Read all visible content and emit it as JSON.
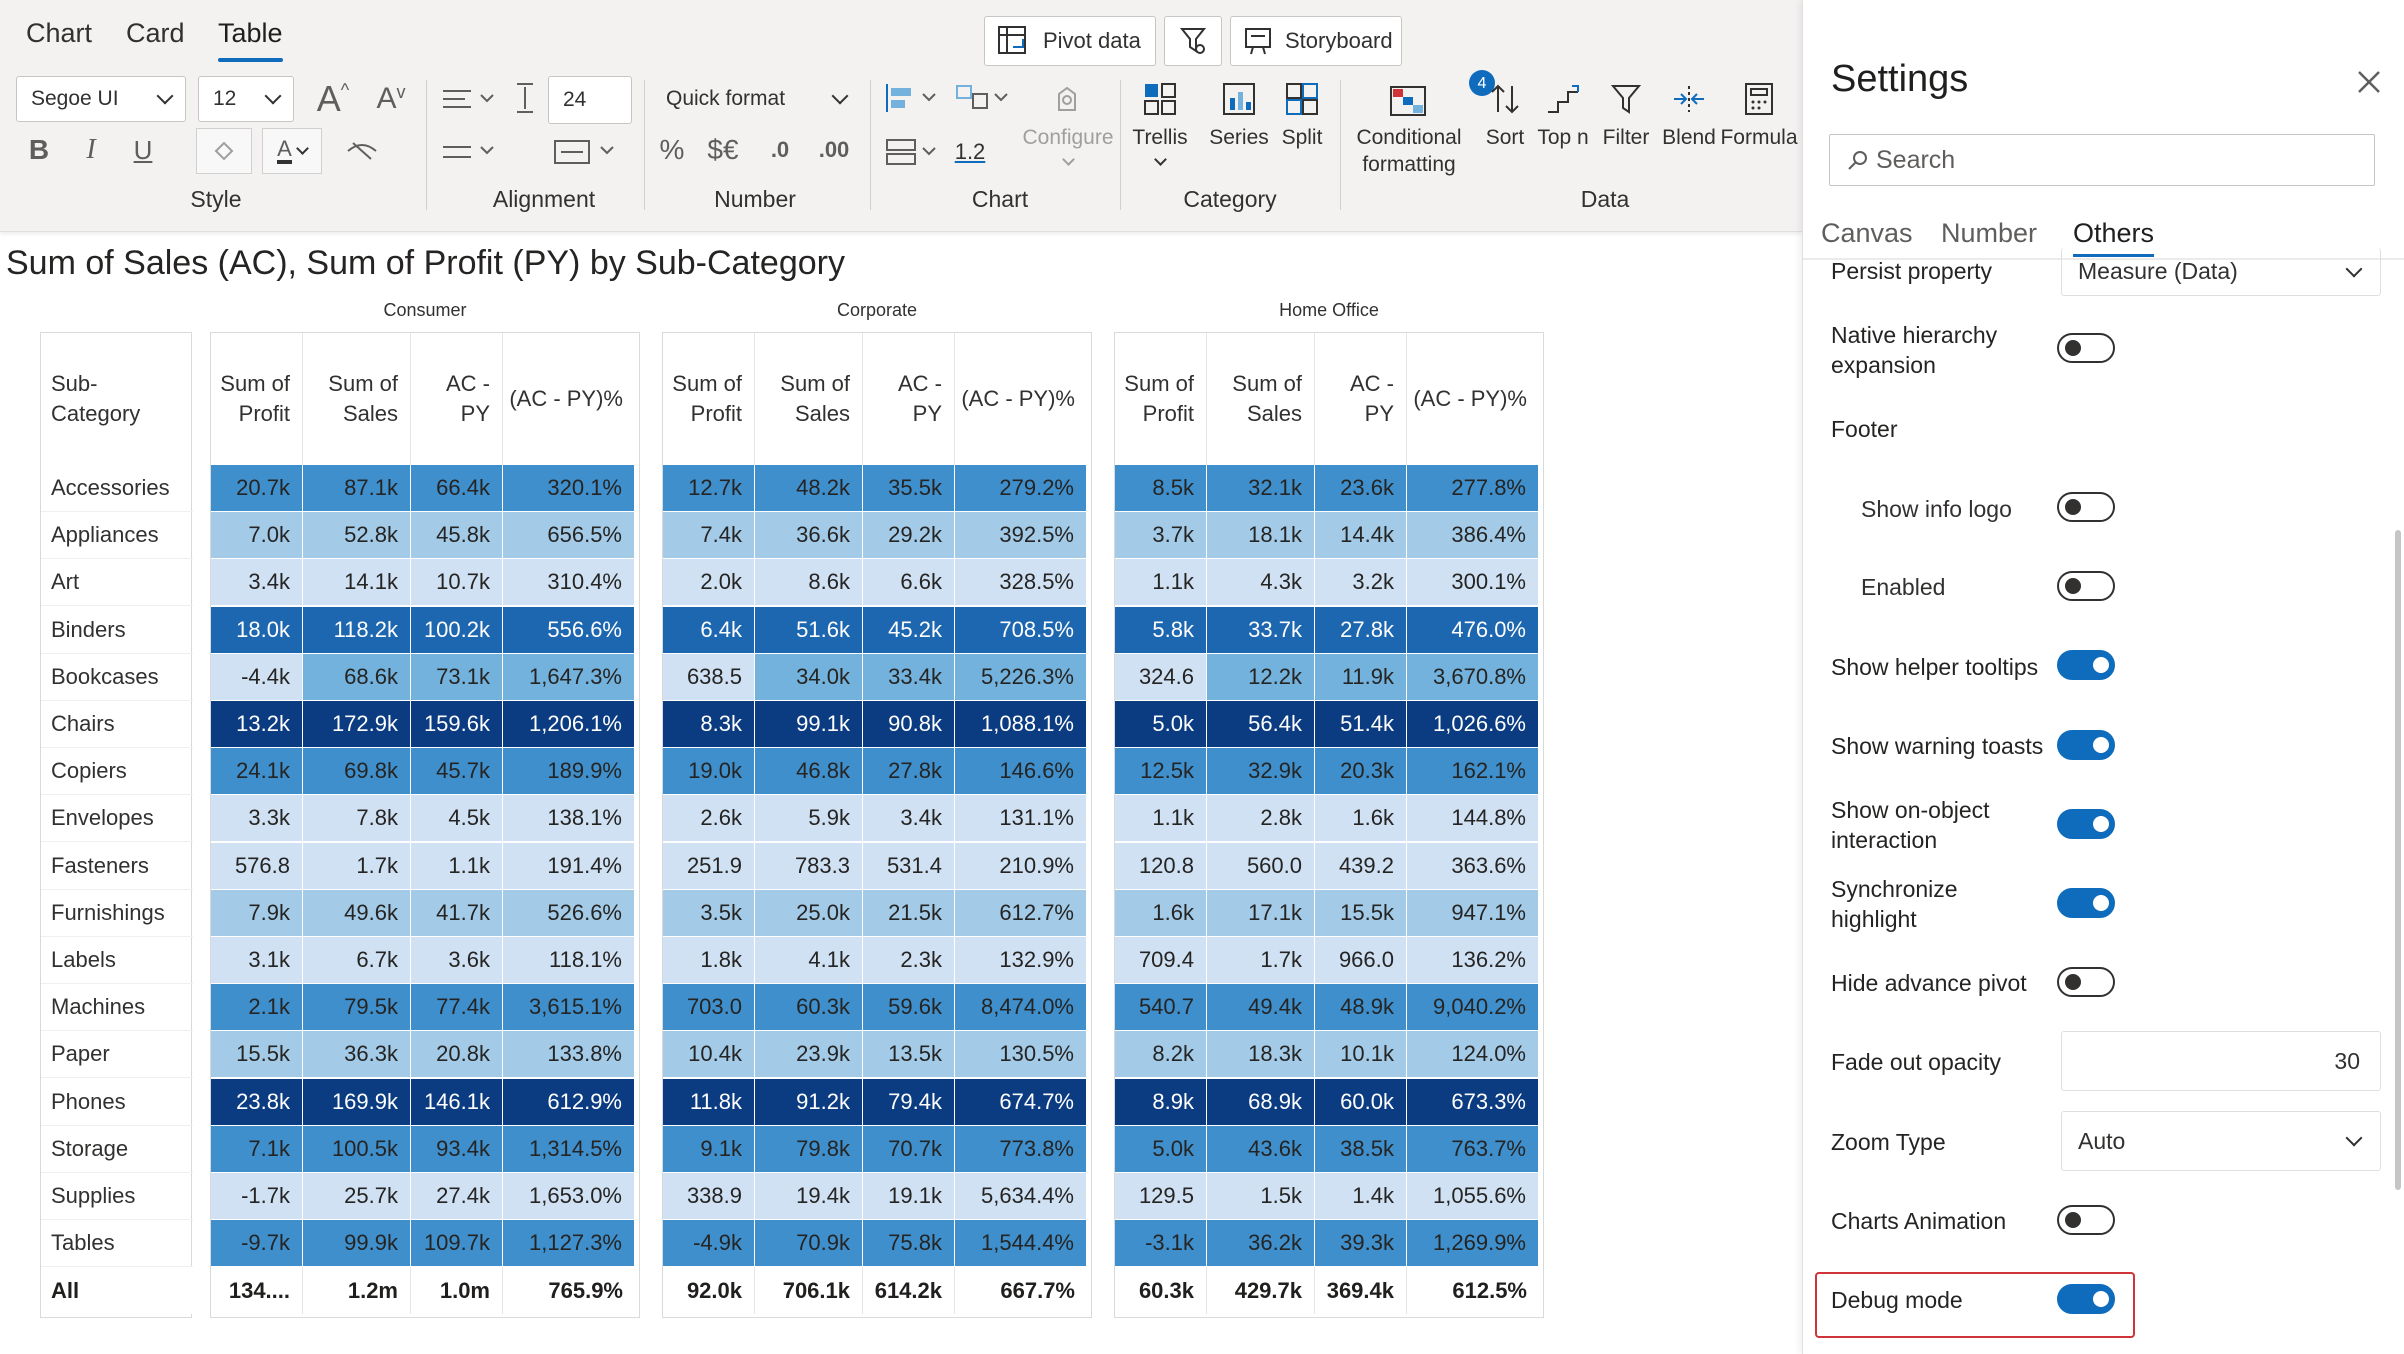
{
  "view_tabs": [
    "Chart",
    "Card",
    "Table"
  ],
  "ribbon": {
    "pivot_data": "Pivot data",
    "storyboard": "Storyboard",
    "font_name": "Segoe UI",
    "font_size": "12",
    "line_height": "24",
    "quick_format": "Quick format",
    "percent_symbol": "%",
    "currency_symbol": "$€",
    "decimals_decrease": ".0",
    "decimals_increase": ".00",
    "number_sample": "1.2",
    "configure": "Configure",
    "trellis": "Trellis",
    "series": "Series",
    "split": "Split",
    "conditional_formatting": "Conditional formatting",
    "cf_badge": "4",
    "sort": "Sort",
    "top_n": "Top n",
    "filter": "Filter",
    "blend": "Blend",
    "formula": "Formula",
    "groups": {
      "style": "Style",
      "alignment": "Alignment",
      "number": "Number",
      "chart": "Chart",
      "category": "Category",
      "data": "Data"
    }
  },
  "visual_title": "Sum of Sales (AC), Sum of Profit (PY) by Sub-Category",
  "table": {
    "row_header": "Sub-Category",
    "groups": [
      "Consumer",
      "Corporate",
      "Home Office"
    ],
    "columns": [
      "Sum of Profit",
      "Sum of Sales",
      "AC - PY",
      "(AC - PY)%"
    ],
    "rows": [
      {
        "name": "Accessories",
        "v": [
          [
            "20.7k",
            "87.1k",
            "66.4k",
            "320.1%"
          ],
          [
            "12.7k",
            "48.2k",
            "35.5k",
            "279.2%"
          ],
          [
            "8.5k",
            "32.1k",
            "23.6k",
            "277.8%"
          ]
        ]
      },
      {
        "name": "Appliances",
        "v": [
          [
            "7.0k",
            "52.8k",
            "45.8k",
            "656.5%"
          ],
          [
            "7.4k",
            "36.6k",
            "29.2k",
            "392.5%"
          ],
          [
            "3.7k",
            "18.1k",
            "14.4k",
            "386.4%"
          ]
        ]
      },
      {
        "name": "Art",
        "v": [
          [
            "3.4k",
            "14.1k",
            "10.7k",
            "310.4%"
          ],
          [
            "2.0k",
            "8.6k",
            "6.6k",
            "328.5%"
          ],
          [
            "1.1k",
            "4.3k",
            "3.2k",
            "300.1%"
          ]
        ]
      },
      {
        "name": "Binders",
        "v": [
          [
            "18.0k",
            "118.2k",
            "100.2k",
            "556.6%"
          ],
          [
            "6.4k",
            "51.6k",
            "45.2k",
            "708.5%"
          ],
          [
            "5.8k",
            "33.7k",
            "27.8k",
            "476.0%"
          ]
        ]
      },
      {
        "name": "Bookcases",
        "v": [
          [
            "-4.4k",
            "68.6k",
            "73.1k",
            "1,647.3%"
          ],
          [
            "638.5",
            "34.0k",
            "33.4k",
            "5,226.3%"
          ],
          [
            "324.6",
            "12.2k",
            "11.9k",
            "3,670.8%"
          ]
        ]
      },
      {
        "name": "Chairs",
        "v": [
          [
            "13.2k",
            "172.9k",
            "159.6k",
            "1,206.1%"
          ],
          [
            "8.3k",
            "99.1k",
            "90.8k",
            "1,088.1%"
          ],
          [
            "5.0k",
            "56.4k",
            "51.4k",
            "1,026.6%"
          ]
        ]
      },
      {
        "name": "Copiers",
        "v": [
          [
            "24.1k",
            "69.8k",
            "45.7k",
            "189.9%"
          ],
          [
            "19.0k",
            "46.8k",
            "27.8k",
            "146.6%"
          ],
          [
            "12.5k",
            "32.9k",
            "20.3k",
            "162.1%"
          ]
        ]
      },
      {
        "name": "Envelopes",
        "v": [
          [
            "3.3k",
            "7.8k",
            "4.5k",
            "138.1%"
          ],
          [
            "2.6k",
            "5.9k",
            "3.4k",
            "131.1%"
          ],
          [
            "1.1k",
            "2.8k",
            "1.6k",
            "144.8%"
          ]
        ]
      },
      {
        "name": "Fasteners",
        "v": [
          [
            "576.8",
            "1.7k",
            "1.1k",
            "191.4%"
          ],
          [
            "251.9",
            "783.3",
            "531.4",
            "210.9%"
          ],
          [
            "120.8",
            "560.0",
            "439.2",
            "363.6%"
          ]
        ]
      },
      {
        "name": "Furnishings",
        "v": [
          [
            "7.9k",
            "49.6k",
            "41.7k",
            "526.6%"
          ],
          [
            "3.5k",
            "25.0k",
            "21.5k",
            "612.7%"
          ],
          [
            "1.6k",
            "17.1k",
            "15.5k",
            "947.1%"
          ]
        ]
      },
      {
        "name": "Labels",
        "v": [
          [
            "3.1k",
            "6.7k",
            "3.6k",
            "118.1%"
          ],
          [
            "1.8k",
            "4.1k",
            "2.3k",
            "132.9%"
          ],
          [
            "709.4",
            "1.7k",
            "966.0",
            "136.2%"
          ]
        ]
      },
      {
        "name": "Machines",
        "v": [
          [
            "2.1k",
            "79.5k",
            "77.4k",
            "3,615.1%"
          ],
          [
            "703.0",
            "60.3k",
            "59.6k",
            "8,474.0%"
          ],
          [
            "540.7",
            "49.4k",
            "48.9k",
            "9,040.2%"
          ]
        ]
      },
      {
        "name": "Paper",
        "v": [
          [
            "15.5k",
            "36.3k",
            "20.8k",
            "133.8%"
          ],
          [
            "10.4k",
            "23.9k",
            "13.5k",
            "130.5%"
          ],
          [
            "8.2k",
            "18.3k",
            "10.1k",
            "124.0%"
          ]
        ]
      },
      {
        "name": "Phones",
        "v": [
          [
            "23.8k",
            "169.9k",
            "146.1k",
            "612.9%"
          ],
          [
            "11.8k",
            "91.2k",
            "79.4k",
            "674.7%"
          ],
          [
            "8.9k",
            "68.9k",
            "60.0k",
            "673.3%"
          ]
        ]
      },
      {
        "name": "Storage",
        "v": [
          [
            "7.1k",
            "100.5k",
            "93.4k",
            "1,314.5%"
          ],
          [
            "9.1k",
            "79.8k",
            "70.7k",
            "773.8%"
          ],
          [
            "5.0k",
            "43.6k",
            "38.5k",
            "763.7%"
          ]
        ]
      },
      {
        "name": "Supplies",
        "v": [
          [
            "-1.7k",
            "25.7k",
            "27.4k",
            "1,653.0%"
          ],
          [
            "338.9",
            "19.4k",
            "19.1k",
            "5,634.4%"
          ],
          [
            "129.5",
            "1.5k",
            "1.4k",
            "1,055.6%"
          ]
        ]
      },
      {
        "name": "Tables",
        "v": [
          [
            "-9.7k",
            "99.9k",
            "109.7k",
            "1,127.3%"
          ],
          [
            "-4.9k",
            "70.9k",
            "75.8k",
            "1,544.4%"
          ],
          [
            "-3.1k",
            "36.2k",
            "39.3k",
            "1,269.9%"
          ]
        ]
      }
    ],
    "total": {
      "name": "All",
      "v": [
        [
          "134....",
          "1.2m",
          "1.0m",
          "765.9%"
        ],
        [
          "92.0k",
          "706.1k",
          "614.2k",
          "667.7%"
        ],
        [
          "60.3k",
          "429.7k",
          "369.4k",
          "612.5%"
        ]
      ]
    },
    "row_shades": [
      [
        3,
        3,
        3,
        3
      ],
      [
        1,
        1,
        1,
        1
      ],
      [
        0,
        0,
        0,
        0
      ],
      [
        4,
        4,
        4,
        4
      ],
      [
        0,
        2,
        2,
        2
      ],
      [
        5,
        5,
        5,
        5
      ],
      [
        3,
        3,
        3,
        3
      ],
      [
        0,
        0,
        0,
        0
      ],
      [
        0,
        0,
        0,
        0
      ],
      [
        1,
        1,
        1,
        1
      ],
      [
        0,
        0,
        0,
        0
      ],
      [
        3,
        3,
        3,
        3
      ],
      [
        1,
        1,
        1,
        1
      ],
      [
        5,
        5,
        5,
        5
      ],
      [
        3,
        3,
        3,
        3
      ],
      [
        0,
        0,
        0,
        0
      ],
      [
        3,
        3,
        3,
        3
      ]
    ],
    "colors": {
      "shade_0": "#cfe1f3",
      "shade_1": "#a3cbe8",
      "shade_2": "#73b2dc",
      "shade_3": "#3e8fcc",
      "shade_4": "#1d66b0",
      "shade_5": "#0b3b80"
    }
  },
  "settings": {
    "title": "Settings",
    "search_placeholder": "Search",
    "tabs": [
      "Canvas",
      "Number",
      "Others"
    ],
    "persist_property_label": "Persist property",
    "persist_property_value": "Measure (Data)",
    "native_hierarchy": "Native hierarchy expansion",
    "footer": "Footer",
    "show_info_logo": "Show info logo",
    "enabled": "Enabled",
    "show_helper_tooltips": "Show helper tooltips",
    "show_warning_toasts": "Show warning toasts",
    "show_on_object": "Show on-object interaction",
    "synchronize_highlight": "Synchronize highlight",
    "hide_advance_pivot": "Hide advance pivot",
    "fade_out_opacity": "Fade out opacity",
    "fade_out_value": "30",
    "zoom_type": "Zoom Type",
    "zoom_type_value": "Auto",
    "charts_animation": "Charts Animation",
    "debug_mode": "Debug mode",
    "accent_color": "#0f6cbd",
    "highlight_color": "#d13438"
  }
}
